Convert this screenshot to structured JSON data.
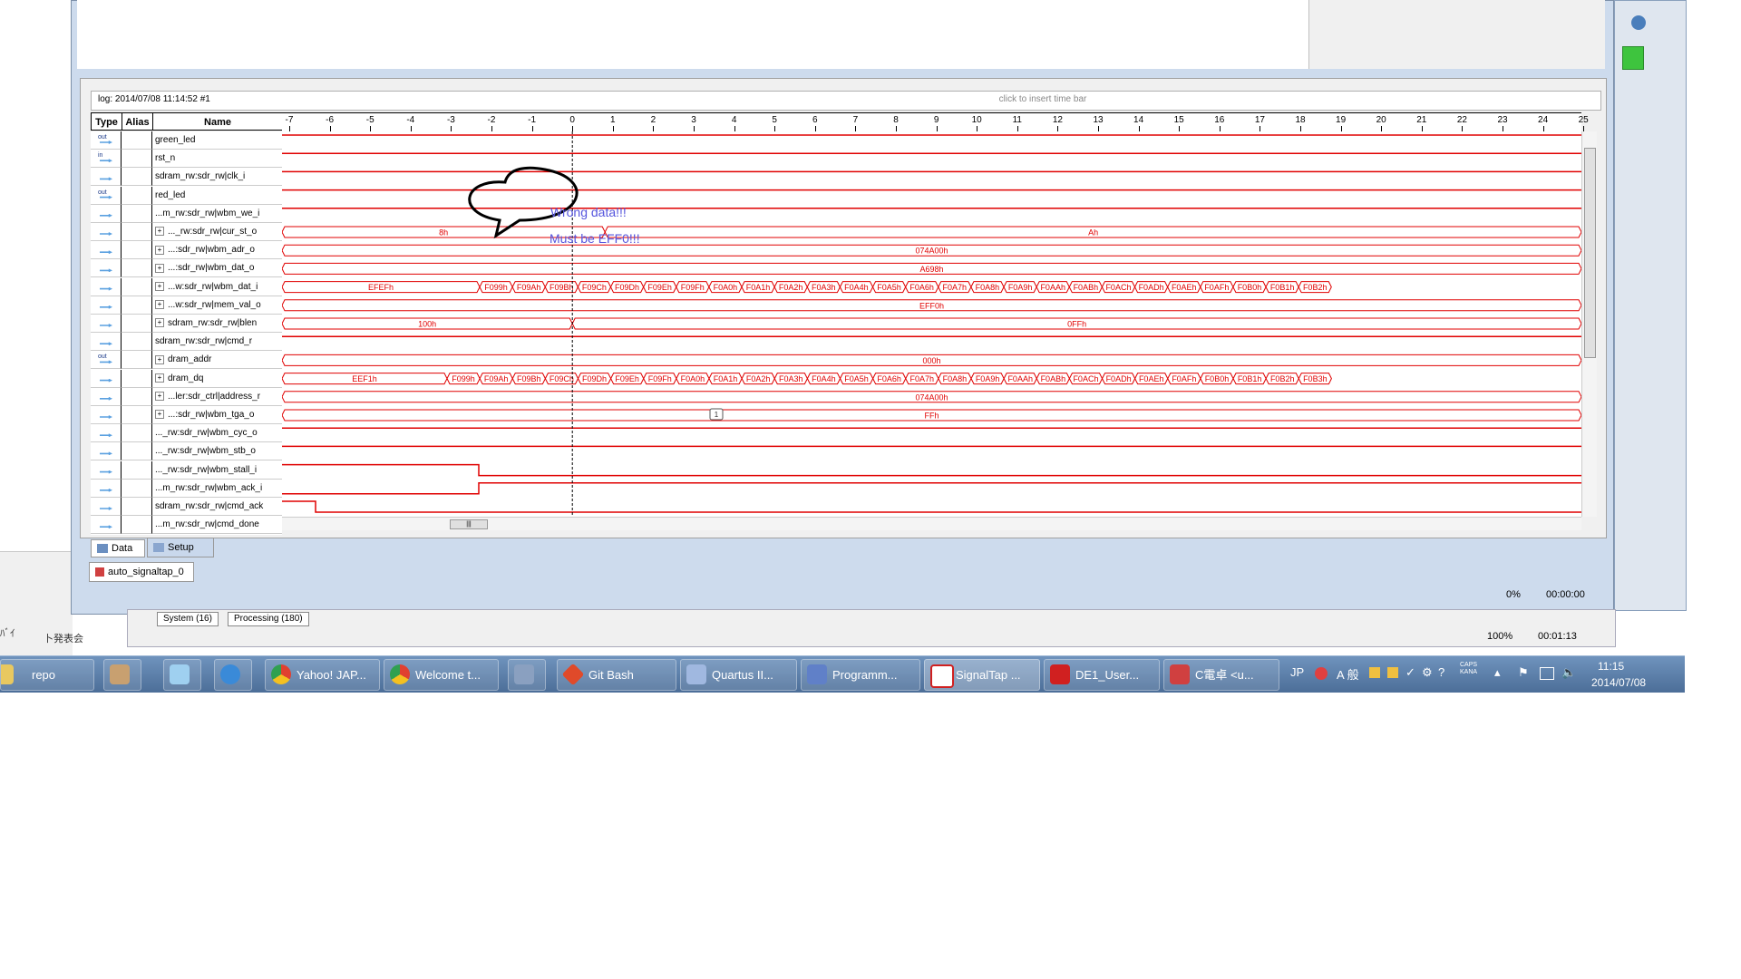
{
  "log": {
    "label": "log: 2014/07/08 11:14:52  #1",
    "timebar_hint": "click to insert time bar"
  },
  "columns": {
    "type": "Type",
    "alias": "Alias",
    "name": "Name"
  },
  "ruler": {
    "ticks": [
      "-7",
      "-6",
      "-5",
      "-4",
      "-3",
      "-2",
      "-1",
      "0",
      "1",
      "2",
      "3",
      "4",
      "5",
      "6",
      "7",
      "8",
      "9",
      "10",
      "11",
      "12",
      "13",
      "14",
      "15",
      "16",
      "17",
      "18",
      "19",
      "20",
      "21",
      "22",
      "23",
      "24",
      "25"
    ]
  },
  "signals": [
    {
      "type": "out",
      "name": "green_led",
      "expandable": false
    },
    {
      "type": "in",
      "name": "rst_n",
      "expandable": false
    },
    {
      "type": "",
      "name": "sdram_rw:sdr_rw|clk_i",
      "expandable": false
    },
    {
      "type": "out",
      "name": "red_led",
      "expandable": false
    },
    {
      "type": "",
      "name": "...m_rw:sdr_rw|wbm_we_i",
      "expandable": false
    },
    {
      "type": "",
      "name": "..._rw:sdr_rw|cur_st_o",
      "expandable": true
    },
    {
      "type": "",
      "name": "...:sdr_rw|wbm_adr_o",
      "expandable": true
    },
    {
      "type": "",
      "name": "...:sdr_rw|wbm_dat_o",
      "expandable": true
    },
    {
      "type": "",
      "name": "...w:sdr_rw|wbm_dat_i",
      "expandable": true
    },
    {
      "type": "",
      "name": "...w:sdr_rw|mem_val_o",
      "expandable": true
    },
    {
      "type": "",
      "name": "sdram_rw:sdr_rw|blen",
      "expandable": true
    },
    {
      "type": "",
      "name": "sdram_rw:sdr_rw|cmd_r",
      "expandable": false
    },
    {
      "type": "out",
      "name": "dram_addr",
      "expandable": true
    },
    {
      "type": "",
      "name": "dram_dq",
      "expandable": true
    },
    {
      "type": "",
      "name": "...ler:sdr_ctrl|address_r",
      "expandable": true
    },
    {
      "type": "",
      "name": "...:sdr_rw|wbm_tga_o",
      "expandable": true
    },
    {
      "type": "",
      "name": "..._rw:sdr_rw|wbm_cyc_o",
      "expandable": false
    },
    {
      "type": "",
      "name": "..._rw:sdr_rw|wbm_stb_o",
      "expandable": false
    },
    {
      "type": "",
      "name": "..._rw:sdr_rw|wbm_stall_i",
      "expandable": false
    },
    {
      "type": "",
      "name": "...m_rw:sdr_rw|wbm_ack_i",
      "expandable": false
    },
    {
      "type": "",
      "name": "sdram_rw:sdr_rw|cmd_ack",
      "expandable": false
    },
    {
      "type": "",
      "name": "...m_rw:sdr_rw|cmd_done",
      "expandable": false
    }
  ],
  "bus_values": {
    "cur_st_o": [
      "8h",
      "Ah"
    ],
    "wbm_adr_o": "074A00h",
    "wbm_dat_o": "A698h",
    "wbm_dat_i": [
      "EFEFh",
      "F099h",
      "F09Ah",
      "F09Bh",
      "F09Ch",
      "F09Dh",
      "F09Eh",
      "F09Fh",
      "F0A0h",
      "F0A1h",
      "F0A2h",
      "F0A3h",
      "F0A4h",
      "F0A5h",
      "F0A6h",
      "F0A7h",
      "F0A8h",
      "F0A9h",
      "F0AAh",
      "F0ABh",
      "F0ACh",
      "F0ADh",
      "F0AEh",
      "F0AFh",
      "F0B0h",
      "F0B1h",
      "F0B2h"
    ],
    "mem_val_o": "EFF0h",
    "blen": [
      "100h",
      "0FFh"
    ],
    "dram_addr": "000h",
    "dram_dq": [
      "EEF1h",
      "F099h",
      "F09Ah",
      "F09Bh",
      "F09Ch",
      "F09Dh",
      "F09Eh",
      "F09Fh",
      "F0A0h",
      "F0A1h",
      "F0A2h",
      "F0A3h",
      "F0A4h",
      "F0A5h",
      "F0A6h",
      "F0A7h",
      "F0A8h",
      "F0A9h",
      "F0AAh",
      "F0ABh",
      "F0ACh",
      "F0ADh",
      "F0AEh",
      "F0AFh",
      "F0B0h",
      "F0B1h",
      "F0B2h",
      "F0B3h"
    ],
    "address_r": "074A00h",
    "wbm_tga_o": "FFh"
  },
  "callout": {
    "line1": "Wrong data!!!",
    "line2": "Must be EFF0!!!"
  },
  "marker_label": "1",
  "tabs": {
    "data": "Data",
    "setup": "Setup"
  },
  "instance_tab": "auto_signaltap_0",
  "status": {
    "percent": "0%",
    "time": "00:00:00"
  },
  "messages": {
    "system": "System (16)",
    "processing": "Processing (180)",
    "percent": "100%",
    "time": "00:01:13"
  },
  "taskbar": {
    "items": [
      "repo",
      "Yahoo! JAP...",
      "Welcome t...",
      "Git Bash",
      "Quartus II...",
      "Programm...",
      "SignalTap ...",
      "DE1_User...",
      "C電卓 <u..."
    ],
    "tray_lang": "JP",
    "clock_time": "11:15",
    "clock_date": "2014/07/08"
  },
  "colors": {
    "wave": "#e00000",
    "callout_text": "#5555dd",
    "taskbar": "#5a7fac"
  }
}
